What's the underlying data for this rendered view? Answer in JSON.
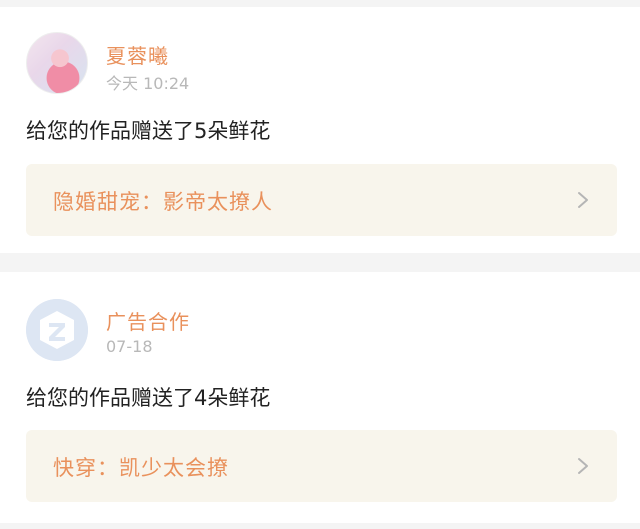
{
  "notifications": [
    {
      "avatar": "user-photo-avatar",
      "name": "夏蓉曦",
      "time": "今天 10:24",
      "message": "给您的作品赠送了5朵鲜花",
      "work_title": "隐婚甜宠：影帝太撩人"
    },
    {
      "avatar": "default-avatar-icon",
      "name": "广告合作",
      "time": "07-18",
      "message": "给您的作品赠送了4朵鲜花",
      "work_title": "快穿：凯少太会撩"
    }
  ],
  "colors": {
    "accent": "#e9915c",
    "link_background": "#f8f5ec",
    "page_background": "#f4f4f4",
    "default_avatar": "#dde6f3"
  }
}
